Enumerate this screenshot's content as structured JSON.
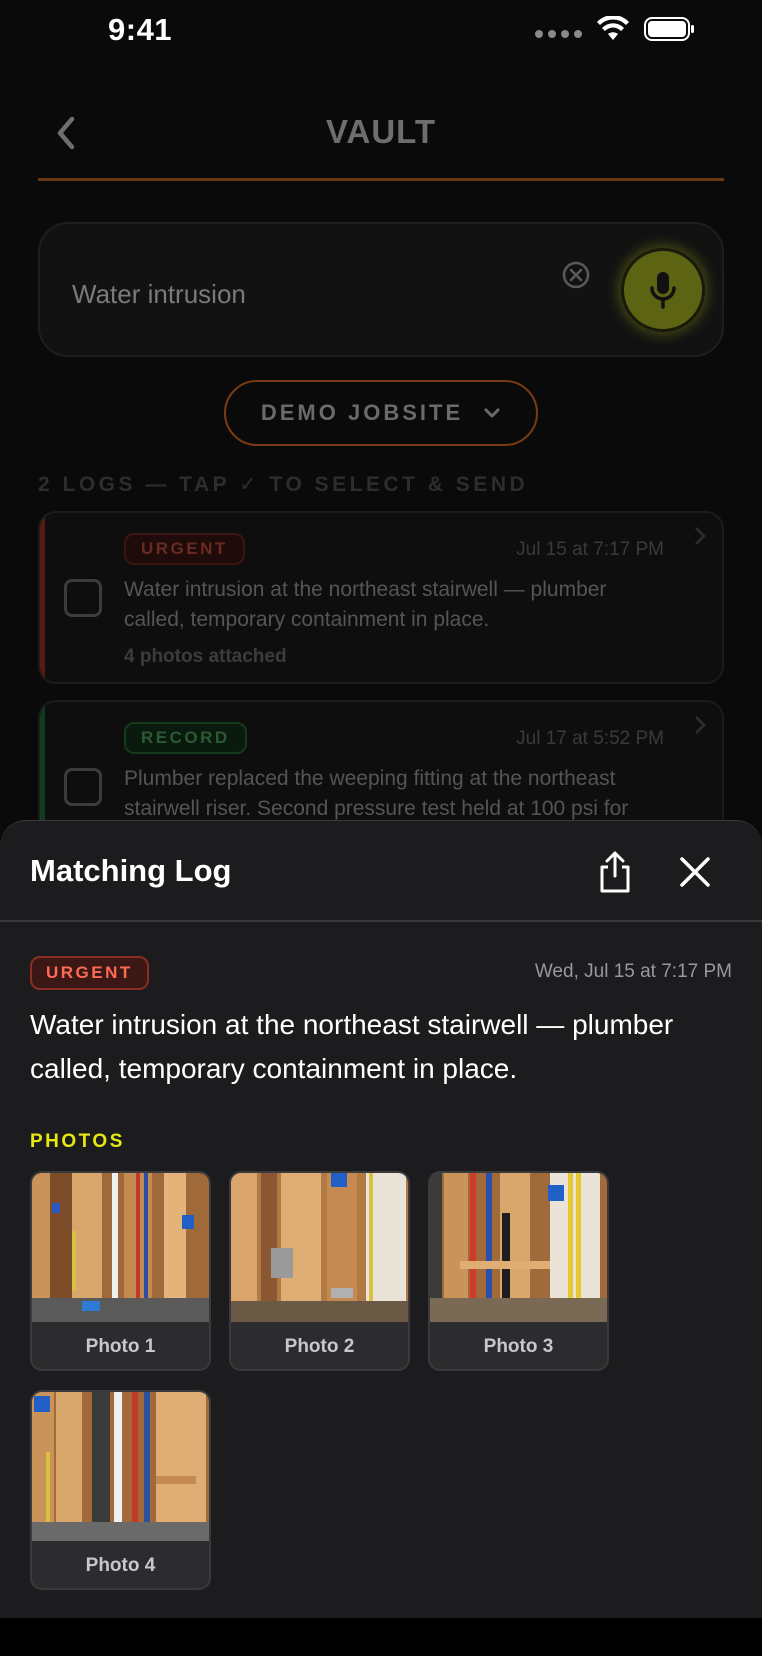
{
  "status_bar": {
    "time": "9:41"
  },
  "nav": {
    "title": "VAULT"
  },
  "search": {
    "value": "Water intrusion"
  },
  "job_selector": {
    "label": "DEMO JOBSITE"
  },
  "logs_header": "2 LOGS — TAP ✓ TO SELECT & SEND",
  "logs": [
    {
      "badge": "URGENT",
      "badge_color": "#e0442e",
      "date": "Jul 15 at 7:17 PM",
      "text": "Water intrusion at the northeast stairwell — plumber called, temporary containment in place.",
      "photos": "4 photos attached"
    },
    {
      "badge": "RECORD",
      "badge_color": "#2d7a3a",
      "date": "Jul 17 at 5:52 PM",
      "text": "Plumber replaced the weeping fitting at the northeast stairwell riser. Second pressure test held at 100 psi for"
    }
  ],
  "sheet": {
    "title": "Matching Log",
    "badge": "URGENT",
    "date": "Wed, Jul 15 at 7:17 PM",
    "body": "Water intrusion at the northeast stairwell — plumber called, temporary containment in place.",
    "photos_label": "PHOTOS",
    "photos": [
      {
        "label": "Photo 1"
      },
      {
        "label": "Photo 2"
      },
      {
        "label": "Photo 3"
      },
      {
        "label": "Photo 4"
      }
    ]
  },
  "colors": {
    "accent_orange": "#7a3b14",
    "mic": "#5c6312",
    "urgent": "#ff6a55",
    "photos_label": "#e6e80e"
  }
}
